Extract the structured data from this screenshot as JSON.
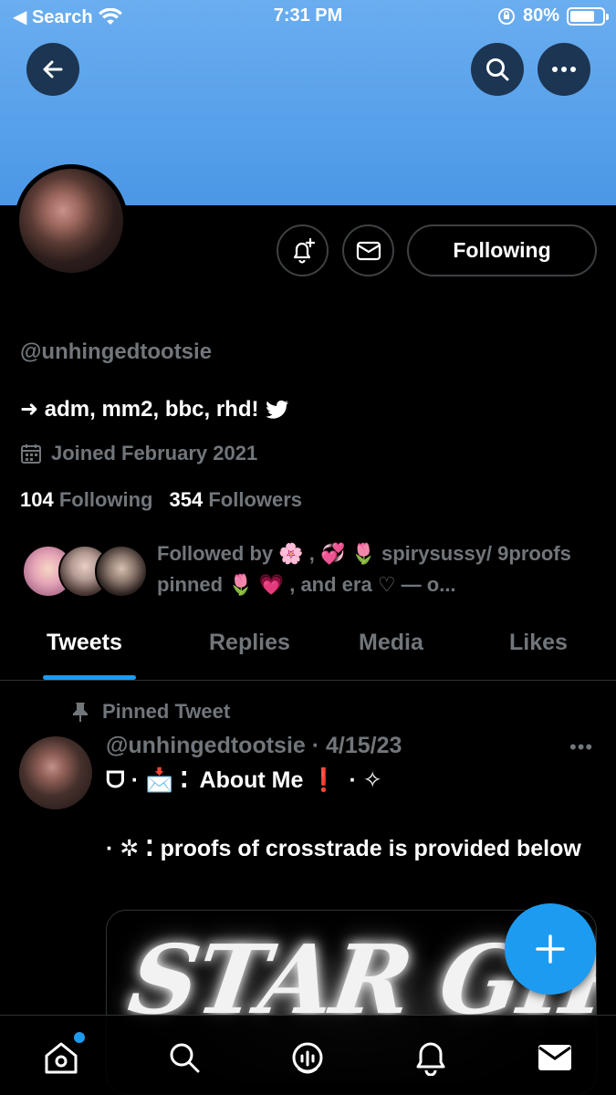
{
  "status_bar": {
    "back_app": "◀ Search",
    "time": "7:31 PM",
    "battery_percent_label": "80%",
    "battery_level": 0.8
  },
  "header": {
    "back_icon": "arrow-left-icon",
    "search_icon": "search-icon",
    "more_icon": "more-horizontal-icon",
    "banner_color": "#4b97e6"
  },
  "profile": {
    "handle": "@unhingedtootsie",
    "bio": "➜ adm, mm2, bbc, rhd!",
    "joined": "Joined February 2021",
    "following_count": "104",
    "following_label": "Following",
    "followers_count": "354",
    "followers_label": "Followers",
    "followed_by": "Followed by 🌸 , 💞 🌷 spirysussy/ 9proofs pinned 🌷 💗 , and era ♡ — o..."
  },
  "actions": {
    "follow_state_label": "Following",
    "notify_icon": "bell-plus-icon",
    "message_icon": "envelope-icon"
  },
  "tabs": [
    {
      "label": "Tweets",
      "active": true
    },
    {
      "label": "Replies",
      "active": false
    },
    {
      "label": "Media",
      "active": false
    },
    {
      "label": "Likes",
      "active": false
    }
  ],
  "pinned_tweet": {
    "pinned_label": "Pinned Tweet",
    "author_line": "@unhingedtootsie · 4/15/23",
    "more_label": "•••",
    "line1_prefix": "ᗜ · 📩 ⁚",
    "line1_text": "About Me ❗",
    "line1_suffix": "· ✧",
    "line2": "· ✲ ⁚ proofs of crosstrade is provided below",
    "media_text": "STAR GIRL"
  },
  "compose": {
    "icon": "plus-icon",
    "color": "#1d9bf0"
  },
  "bottom_nav": [
    {
      "name": "home",
      "icon": "home-icon",
      "has_dot": true
    },
    {
      "name": "search",
      "icon": "search-icon"
    },
    {
      "name": "spaces",
      "icon": "spaces-icon"
    },
    {
      "name": "notifications",
      "icon": "bell-icon"
    },
    {
      "name": "messages",
      "icon": "envelope-icon"
    }
  ]
}
